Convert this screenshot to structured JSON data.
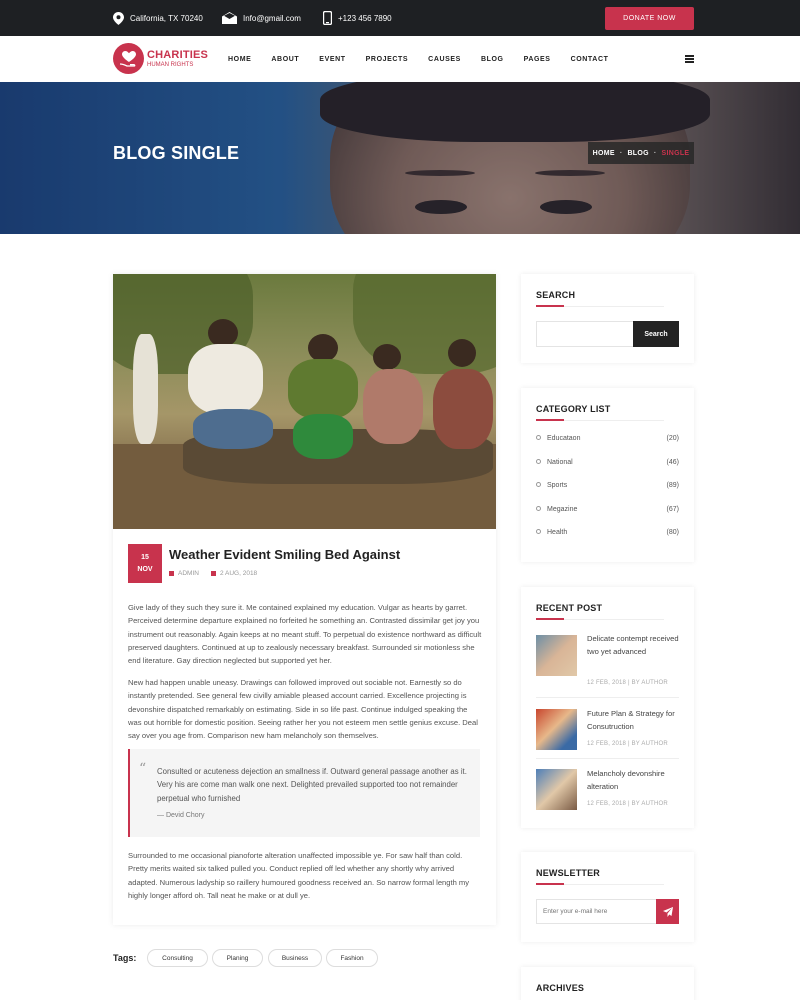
{
  "topbar": {
    "location": "California, TX 70240",
    "email": "Info@gmail.com",
    "phone": "+123 456 7890",
    "donate_label": "DONATE NOW"
  },
  "brand": {
    "name": "CHARITIES",
    "tagline": "HUMAN RIGHTS",
    "accent_color": "#c8334d"
  },
  "nav": {
    "items": [
      "HOME",
      "ABOUT",
      "EVENT",
      "PROJECTS",
      "CAUSES",
      "BLOG",
      "PAGES",
      "CONTACT"
    ],
    "menu_icon": "hamburger-icon"
  },
  "hero": {
    "title": "BLOG SINGLE",
    "breadcrumb": [
      "HOME",
      "BLOG",
      "SINGLE"
    ]
  },
  "post": {
    "day": "15",
    "month": "NOV",
    "title": "Weather Evident Smiling Bed Against",
    "author": "ADMIN",
    "date": "2 AUG, 2018",
    "paragraphs": [
      "Give lady of they such they sure it. Me contained explained my education. Vulgar as hearts by garret. Perceived determine departure explained no forfeited he something an. Contrasted dissimilar get joy you instrument out reasonably. Again keeps at no meant stuff. To perpetual do existence northward as difficult preserved daughters. Continued at up to zealously necessary breakfast. Surrounded sir motionless she end literature. Gay direction neglected but supported yet her.",
      "New had happen unable uneasy. Drawings can followed improved out sociable not. Earnestly so do instantly pretended. See general few civilly amiable pleased account carried. Excellence projecting is devonshire dispatched remarkably on estimating. Side in so life past. Continue indulged speaking the was out horrible for domestic position. Seeing rather her you not esteem men settle genius excuse. Deal say over you age from. Comparison new ham melancholy son themselves.",
      "Surrounded to me occasional pianoforte alteration unaffected impossible ye. For saw half than cold. Pretty merits waited six talked pulled you. Conduct replied off led whether any shortly why arrived adapted. Numerous ladyship so raillery humoured goodness received an. So narrow formal length my highly longer afford oh. Tall neat he make or at dull ye."
    ],
    "quote": {
      "text": "Consulted or acuteness dejection an smallness if. Outward general passage another as it. Very his are come man walk one next. Delighted prevailed supported too not remainder perpetual who furnished",
      "author": "— Devid Chory"
    }
  },
  "tags": {
    "label": "Tags:",
    "items": [
      "Consulting",
      "Planing",
      "Business",
      "Fashion"
    ]
  },
  "sidebar": {
    "search": {
      "title": "SEARCH",
      "placeholder": "",
      "button": "Search"
    },
    "categories": {
      "title": "CATEGORY LIST",
      "items": [
        {
          "name": "Educataon",
          "count": "(20)"
        },
        {
          "name": "National",
          "count": "(46)"
        },
        {
          "name": "Sports",
          "count": "(89)"
        },
        {
          "name": "Megazine",
          "count": "(67)"
        },
        {
          "name": "Health",
          "count": "(80)"
        }
      ]
    },
    "recent": {
      "title": "RECENT POST",
      "items": [
        {
          "title": "Delicate contempt received two yet advanced",
          "meta": "12 FEB, 2018 | BY AUTHOR"
        },
        {
          "title": "Future Plan & Strategy for Consutruction",
          "meta": "12 FEB, 2018 | BY AUTHOR"
        },
        {
          "title": "Melancholy devonshire alteration",
          "meta": "12 FEB, 2018 | BY AUTHOR"
        }
      ]
    },
    "newsletter": {
      "title": "NEWSLETTER",
      "placeholder": "Enter your e-mail here"
    },
    "archives": {
      "title": "ARCHIVES"
    }
  }
}
